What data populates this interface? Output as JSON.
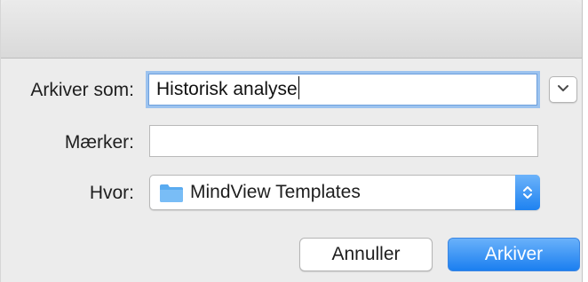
{
  "dialog": {
    "save_as": {
      "label": "Arkiver som:",
      "value": "Historisk analyse"
    },
    "tags": {
      "label": "Mærker:",
      "value": ""
    },
    "where": {
      "label": "Hvor:",
      "value": "MindView Templates"
    },
    "buttons": {
      "cancel": "Annuller",
      "save": "Arkiver"
    }
  },
  "colors": {
    "accent": "#1b7ff0",
    "folder": "#5aabf0",
    "focus_ring": "#9cc3ef",
    "dialog_bg": "#ececec"
  },
  "icons": {
    "disclosure": "chevron-down-icon",
    "location": "folder-icon",
    "popup_indicator": "up-down-arrows-icon"
  }
}
